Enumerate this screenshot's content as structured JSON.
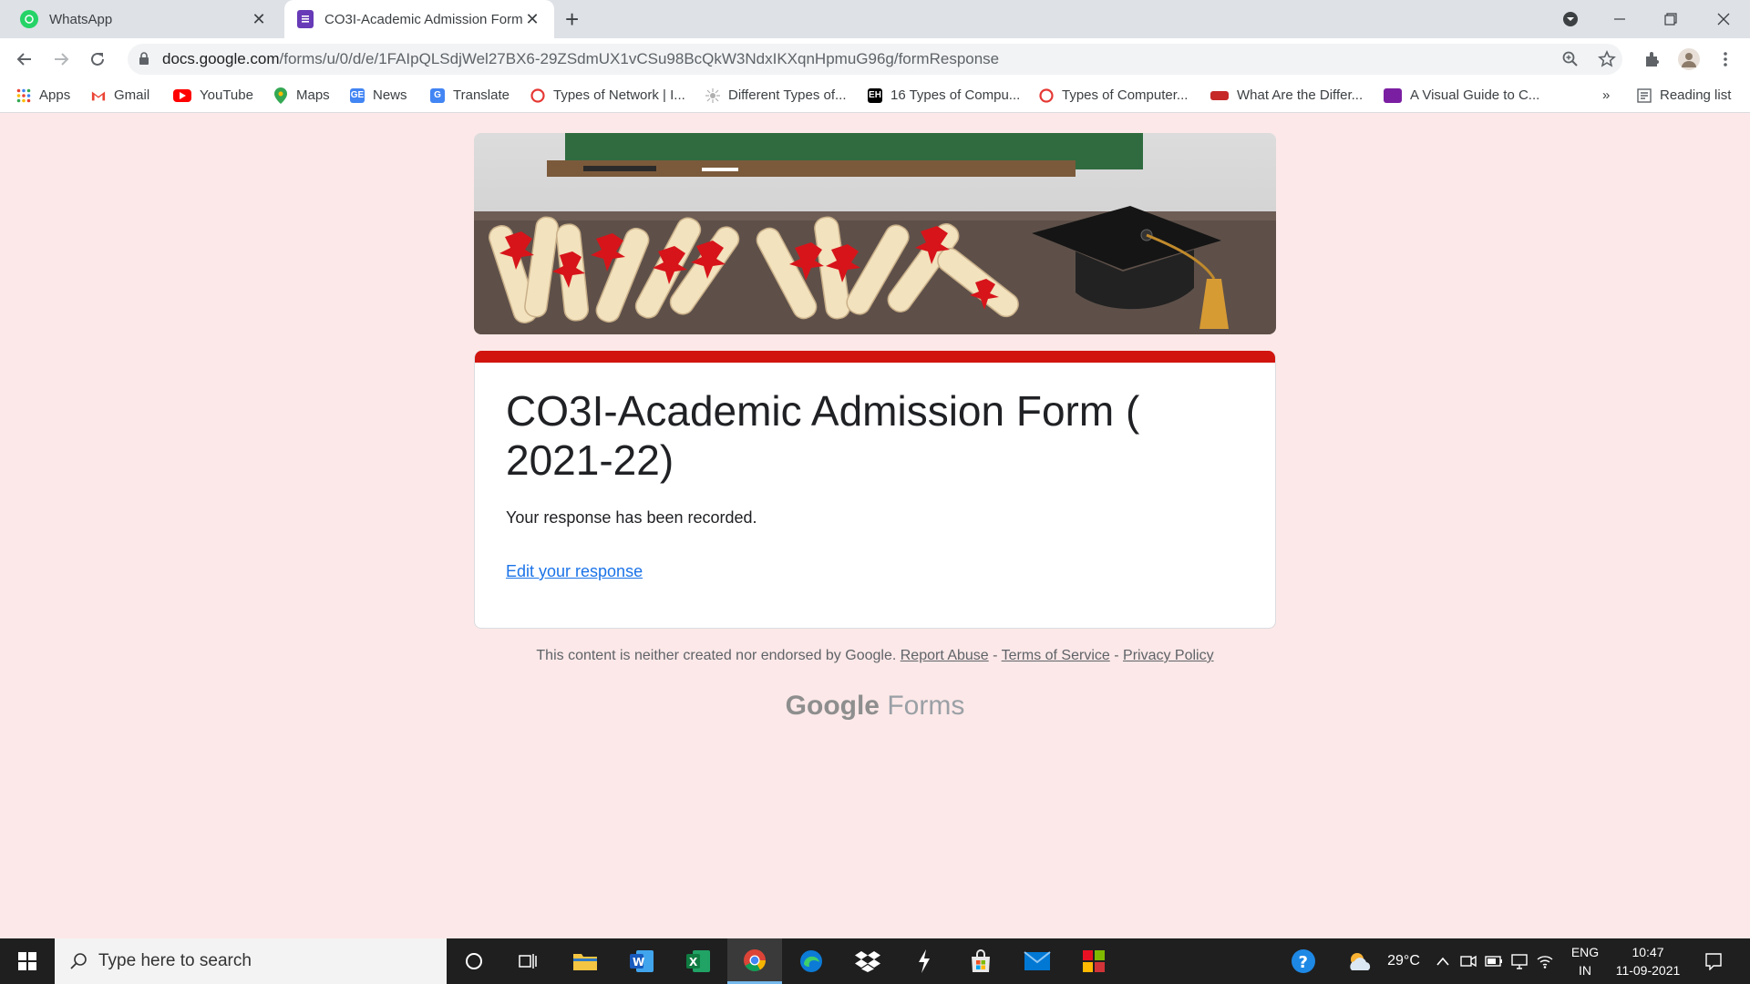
{
  "browser": {
    "tabs": [
      {
        "title": "WhatsApp",
        "icon": "whatsapp-icon",
        "active": false
      },
      {
        "title": "CO3I-Academic Admission Form",
        "icon": "google-forms-icon",
        "active": true
      }
    ],
    "new_tab": "+",
    "url_host": "docs.google.com",
    "url_path": "/forms/u/0/d/e/1FAIpQLSdjWel27BX6-29ZSdmUX1vCSu98BcQkW3NdxIKXqnHpmuG96g/formResponse"
  },
  "bookmarks": {
    "items": [
      {
        "label": "Apps",
        "icon": "apps-grid-icon",
        "color": "#4285f4"
      },
      {
        "label": "Gmail",
        "icon": "gmail-icon",
        "color": "#ea4335"
      },
      {
        "label": "YouTube",
        "icon": "youtube-icon",
        "color": "#ff0000"
      },
      {
        "label": "Maps",
        "icon": "maps-pin-icon",
        "color": "#34a853"
      },
      {
        "label": "News",
        "icon": "google-news-icon",
        "color": "#4285f4"
      },
      {
        "label": "Translate",
        "icon": "translate-icon",
        "color": "#4285f4"
      },
      {
        "label": "Types of Network | I...",
        "icon": "site-icon",
        "color": "#e53935"
      },
      {
        "label": "Different Types of...",
        "icon": "site-icon",
        "color": "#9e9e9e"
      },
      {
        "label": "16 Types of Compu...",
        "icon": "site-icon",
        "color": "#000000"
      },
      {
        "label": "Types of Computer...",
        "icon": "site-icon",
        "color": "#e53935"
      },
      {
        "label": "What Are the Differ...",
        "icon": "site-icon",
        "color": "#c62828"
      },
      {
        "label": "A Visual Guide to C...",
        "icon": "site-icon",
        "color": "#7b1fa2"
      }
    ],
    "overflow": "»",
    "reading_list": "Reading list"
  },
  "form": {
    "title": "CO3I-Academic Admission Form ( 2021-22)",
    "message": "Your response has been recorded.",
    "edit_link": "Edit your response",
    "accent_color": "#d2140f"
  },
  "footer": {
    "disclaimer": "This content is neither created nor endorsed by Google.",
    "report_abuse": "Report Abuse",
    "terms": "Terms of Service",
    "privacy": "Privacy Policy",
    "separator": "-",
    "brand_google": "Google",
    "brand_forms": "Forms"
  },
  "taskbar": {
    "search_placeholder": "Type here to search",
    "weather": "29°C",
    "language_top": "ENG",
    "language_bottom": "IN",
    "time": "10:47",
    "date": "11-09-2021"
  }
}
